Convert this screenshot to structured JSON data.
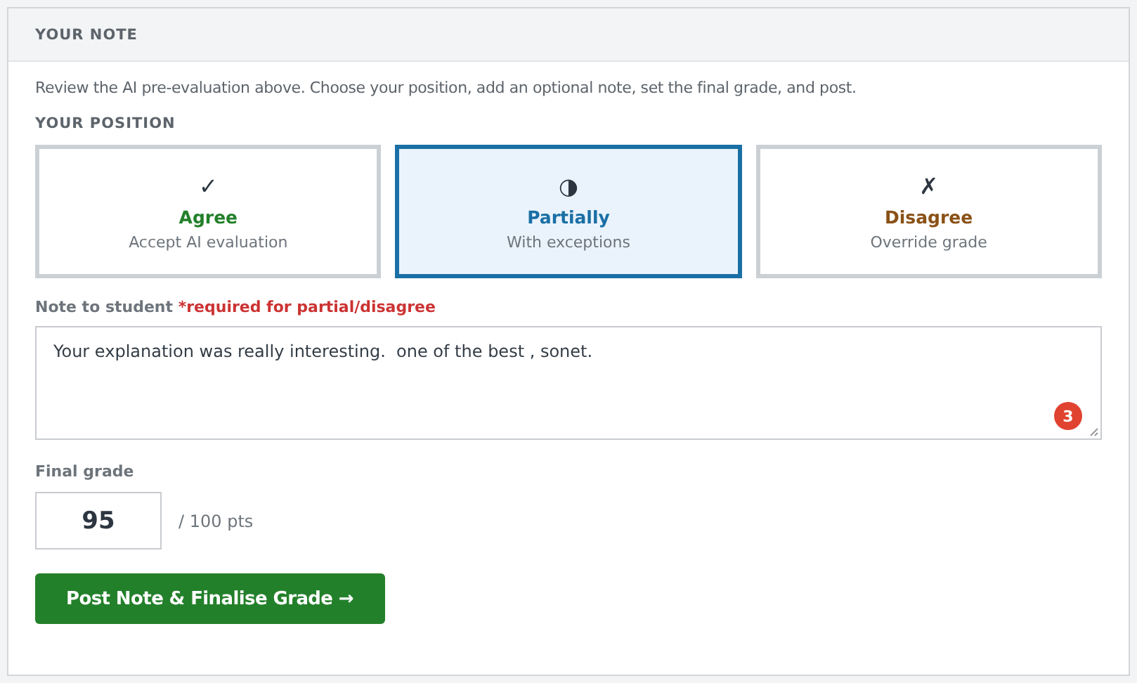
{
  "panel": {
    "title": "YOUR NOTE"
  },
  "intro": "Review the AI pre-evaluation above. Choose your position, add an optional note, set the final grade, and post.",
  "position": {
    "label": "YOUR POSITION",
    "options": [
      {
        "kind": "agree",
        "icon": "✓",
        "label": "Agree",
        "caption": "Accept AI evaluation",
        "selected": false
      },
      {
        "kind": "partial",
        "icon": "◑",
        "label": "Partially",
        "caption": "With exceptions",
        "selected": true
      },
      {
        "kind": "disagree",
        "icon": "✗",
        "label": "Disagree",
        "caption": "Override grade",
        "selected": false
      }
    ]
  },
  "note": {
    "label": "Note to student",
    "required": "*required for partial/disagree",
    "value": "Your explanation was really interesting.  one of the best , sonet.",
    "badge": "3"
  },
  "grade": {
    "label": "Final grade",
    "value": "95",
    "suffix": "/ 100 pts"
  },
  "submit": "Post Note & Finalise Grade →"
}
